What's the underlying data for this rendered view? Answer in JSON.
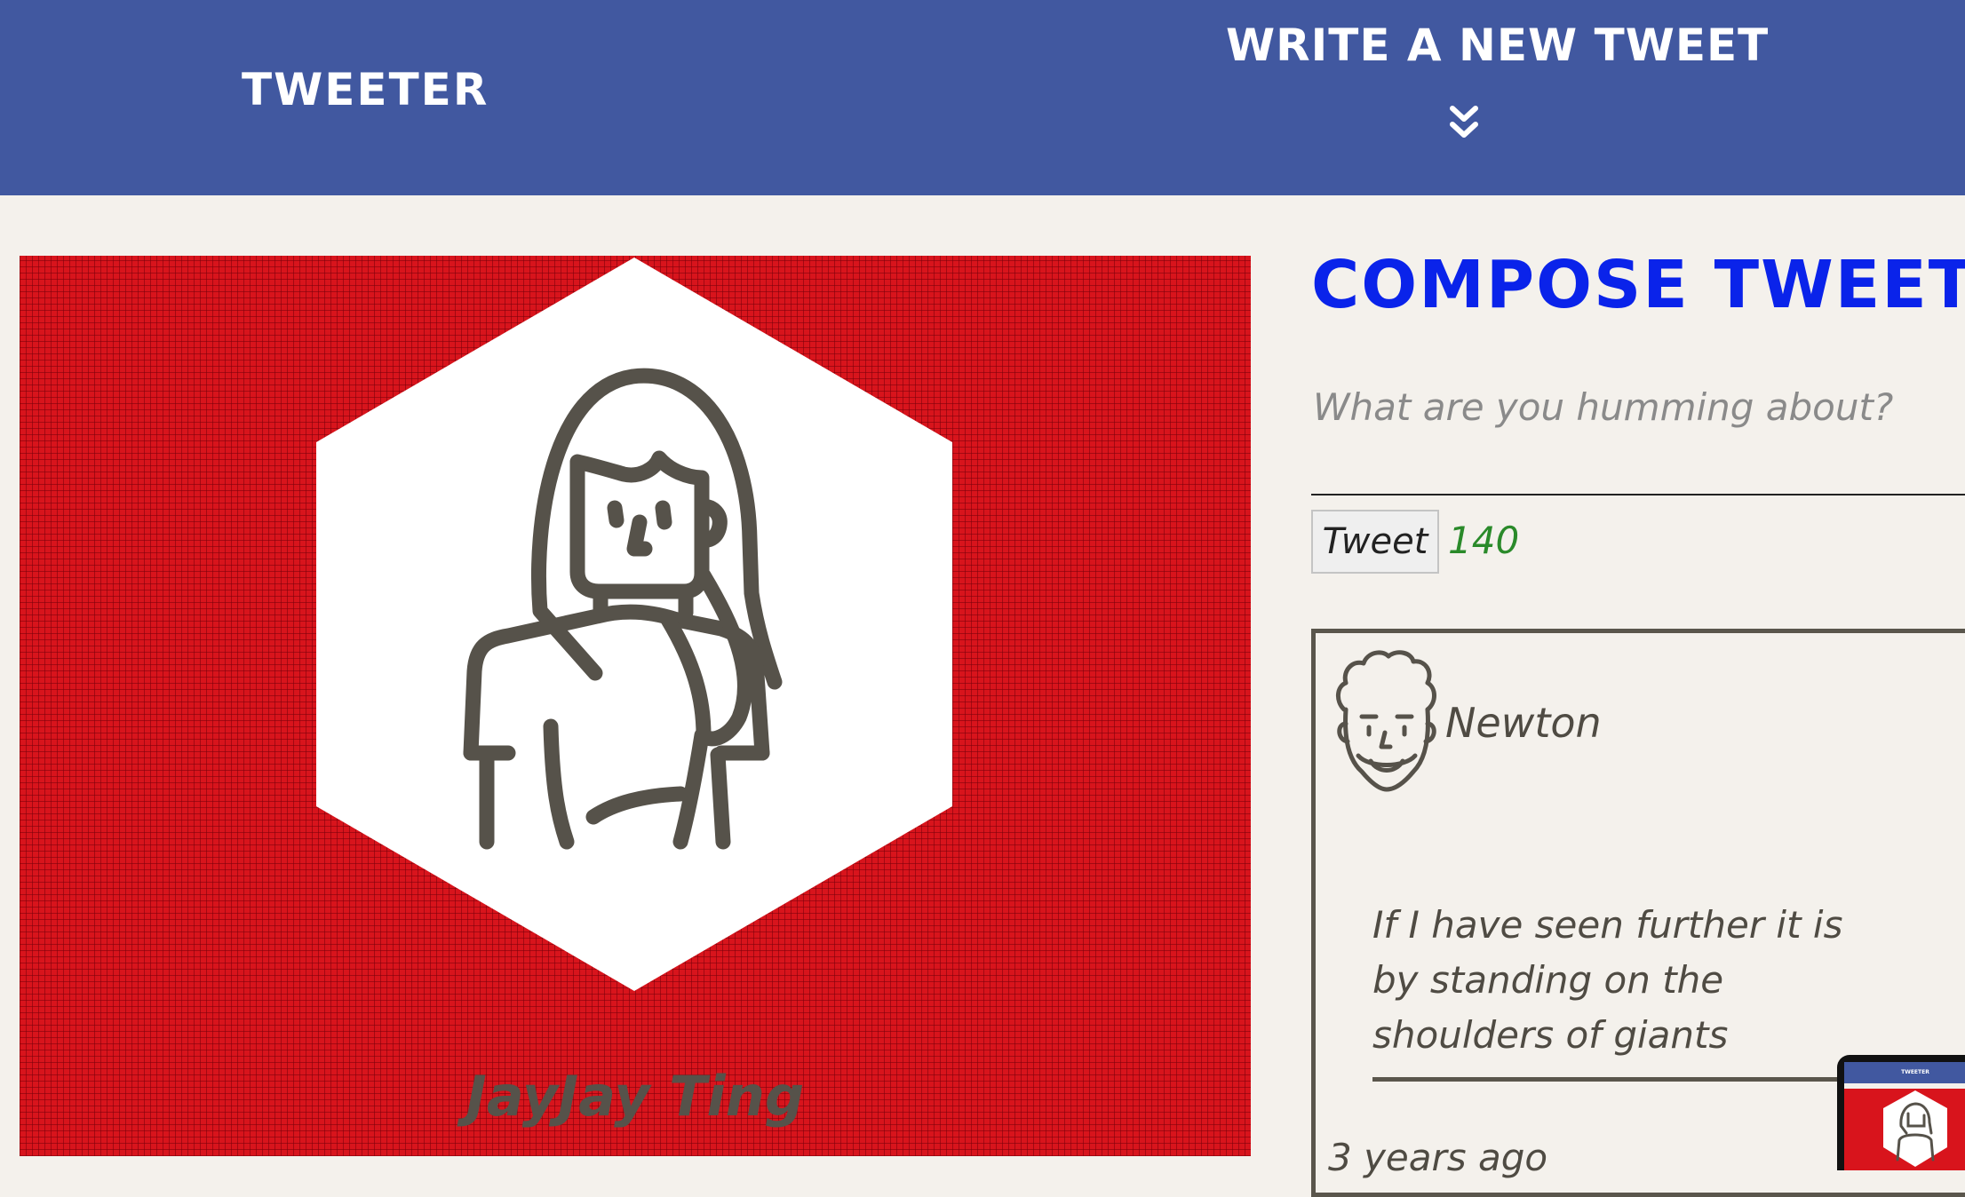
{
  "header": {
    "brand": "TWEETER",
    "compose_toggle_label": "WRITE A NEW TWEET"
  },
  "profile": {
    "name": "JayJay Ting"
  },
  "compose": {
    "title": "COMPOSE TWEET",
    "placeholder": "What are you humming about?",
    "button_label": "Tweet",
    "counter": "140"
  },
  "tweets": [
    {
      "author": "Newton",
      "text": "If I have seen further it is by standing on the shoulders of giants",
      "time": "3 years ago"
    }
  ],
  "thumbnail": {
    "brand": "TWEETER"
  },
  "colors": {
    "header_bg": "#4158a0",
    "page_bg": "#f4f1ec",
    "profile_bg": "#d8141c",
    "compose_title": "#0a23ea",
    "counter": "#2a8a2a",
    "ink": "#56524a"
  },
  "icons": {
    "compose_toggle": "double-chevron-down-icon",
    "profile_avatar": "woman-avatar-icon",
    "tweet_avatar": "man-avatar-icon"
  }
}
